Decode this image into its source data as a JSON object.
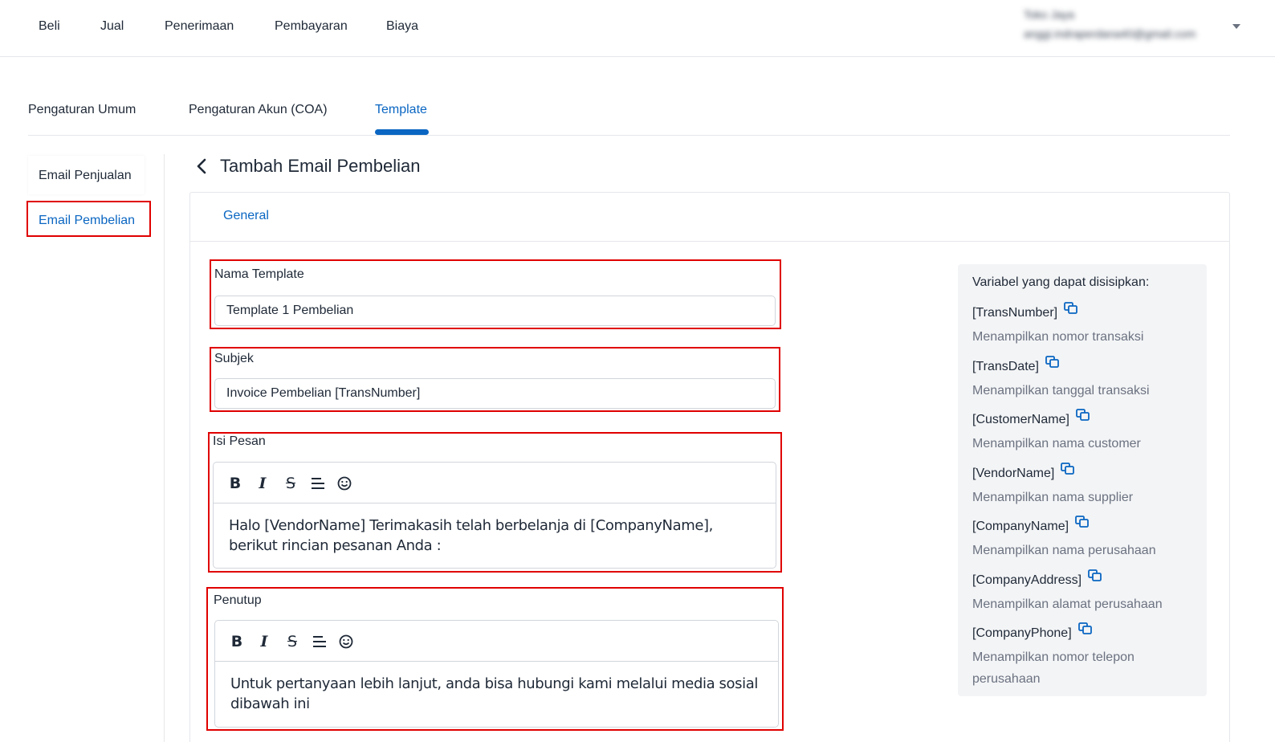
{
  "topnav": {
    "menu": [
      "Beli",
      "Jual",
      "Penerimaan",
      "Pembayaran",
      "Biaya"
    ],
    "user_name": "Toko Jaya",
    "user_email": "anggi.indraperdana40@gmail.com"
  },
  "tabs": [
    "Pengaturan Umum",
    "Pengaturan Akun (COA)",
    "Template"
  ],
  "sidebar": [
    "Email Penjualan",
    "Email Pembelian"
  ],
  "page_title": "Tambah Email Pembelian",
  "card_tab": "General",
  "form": {
    "template_name_label": "Nama Template",
    "template_name_value": "Template 1 Pembelian",
    "subject_label": "Subjek",
    "subject_value": "Invoice Pembelian [TransNumber]",
    "body_label": "Isi Pesan",
    "body_text": "Halo [VendorName] Terimakasih telah berbelanja di [CompanyName], berikut rincian pesanan Anda :",
    "closing_label": "Penutup",
    "closing_text": "Untuk pertanyaan lebih lanjut, anda bisa hubungi kami melalui media sosial dibawah ini"
  },
  "toolbar_icons": [
    "bold-icon",
    "italic-icon",
    "strikethrough-icon",
    "align-icon",
    "emoji-icon"
  ],
  "variables": {
    "title": "Variabel yang dapat disisipkan:",
    "items": [
      {
        "name": "[TransNumber]",
        "desc": "Menampilkan nomor transaksi"
      },
      {
        "name": "[TransDate]",
        "desc": "Menampilkan tanggal transaksi"
      },
      {
        "name": "[CustomerName]",
        "desc": "Menampilkan nama customer"
      },
      {
        "name": "[VendorName]",
        "desc": "Menampilkan nama supplier"
      },
      {
        "name": "[CompanyName]",
        "desc": "Menampilkan nama perusahaan"
      },
      {
        "name": "[CompanyAddress]",
        "desc": "Menampilkan alamat perusahaan"
      },
      {
        "name": "[CompanyPhone]",
        "desc": "Menampilkan nomor telepon perusahaan"
      }
    ]
  },
  "colors": {
    "accent": "#0a66c2",
    "highlight": "#e00000",
    "panel": "#f3f4f6"
  }
}
